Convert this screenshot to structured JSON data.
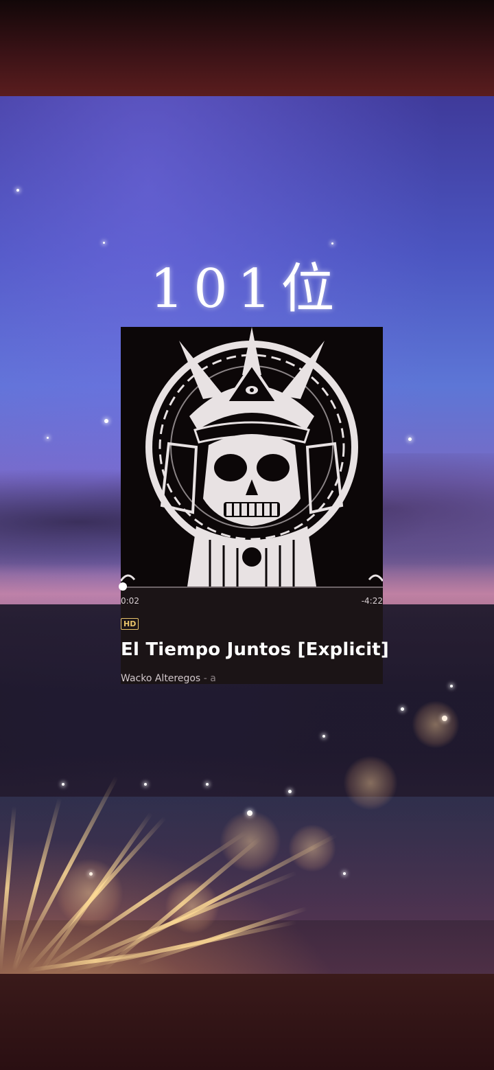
{
  "overlay": {
    "rank_label": "101位"
  },
  "player": {
    "progress": 0.008,
    "elapsed_time": "0:02",
    "remaining_time": "-4:22",
    "quality_badge": "HD",
    "song_title": "El Tiempo Juntos [Explicit]",
    "artist": "Wacko Alteregos",
    "artist_separator": "-",
    "album_fragment": "a"
  },
  "colors": {
    "hd_badge": "#e9c46a",
    "progress_fill": "#ffffff",
    "player_background": "#1b1416"
  }
}
